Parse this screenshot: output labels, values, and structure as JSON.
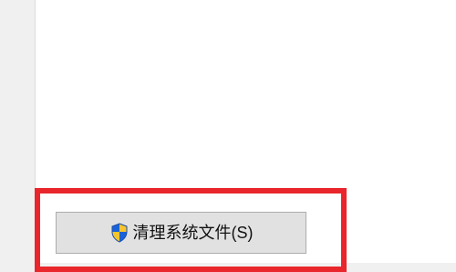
{
  "cleanup_button": {
    "label": "清理系统文件(S)",
    "icon": "uac-shield-icon"
  }
}
